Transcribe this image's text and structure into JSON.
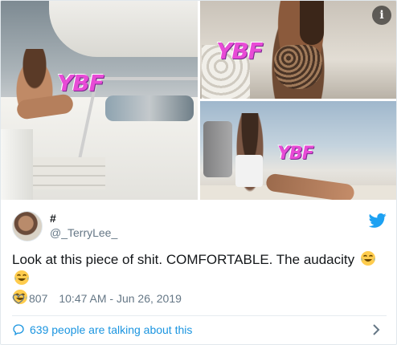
{
  "media": {
    "watermark": "YBF",
    "info_icon": "info-icon"
  },
  "tweet": {
    "display_name": "#",
    "handle": "@_TerryLee_",
    "text": "Look at this piece of shit. COMFORTABLE. The audacity",
    "emojis": [
      "face-with-tears-of-joy",
      "face-with-tears-of-joy",
      "face-with-tears-of-joy"
    ],
    "likes": "807",
    "timestamp": "10:47 AM - Jun 26, 2019"
  },
  "footer": {
    "conversation_label": "639 people are talking about this"
  },
  "colors": {
    "brand": "#1da1f2",
    "link": "#1b95e0",
    "secondary_text": "#657786",
    "watermark": "#e84bd6"
  },
  "icons": [
    "info-icon",
    "twitter-bird-icon",
    "heart-icon",
    "chat-bubble-icon",
    "chevron-right-icon"
  ]
}
